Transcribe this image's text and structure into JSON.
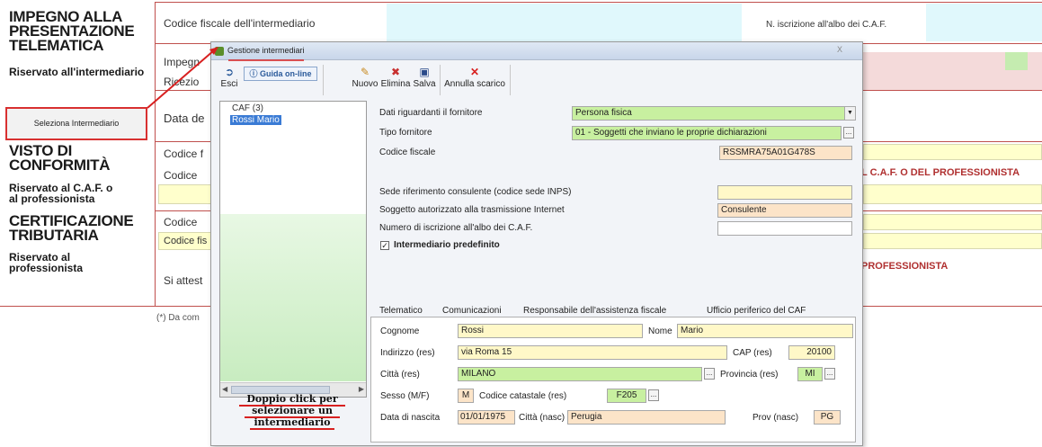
{
  "background_form": {
    "sections": [
      {
        "title": "IMPEGNO ALLA PRESENTAZIONE TELEMATICA",
        "subtitle": "Riservato all'intermediario"
      },
      {
        "title": "VISTO DI CONFORMITÀ",
        "subtitle": "Riservato al C.A.F. o al professionista"
      },
      {
        "title": "CERTIFICAZIONE TRIBUTARIA",
        "subtitle": "Riservato al professionista"
      }
    ],
    "row_labels": {
      "codice_fiscale_intermediario": "Codice fiscale dell'intermediario",
      "n_iscrizione": "N. iscrizione all'albo dei C.A.F.",
      "impegno": "Impegn",
      "ricezione": "Ricezio",
      "data": "Data de",
      "codice_1": "Codice f",
      "codice_2": "Codice",
      "codice_3": "Codice",
      "codice_4": "Codice fis",
      "si_attesta": "Si attest",
      "caf_professionista": "L C.A.F. O DEL PROFESSIONISTA",
      "professionista": "PROFESSIONISTA",
      "footnote": "(*) Da com"
    },
    "select_button": "Seleziona Intermediario"
  },
  "dialog": {
    "title": "Gestione intermediari",
    "close_label": "X",
    "toolbar": {
      "esci": "Esci",
      "guida": "Guida on-line",
      "nuovo": "Nuovo",
      "elimina": "Elimina",
      "salva": "Salva",
      "annulla_scarico": "Annulla scarico"
    },
    "tree": {
      "root": "CAF (3)",
      "selected": "Rossi  Mario"
    },
    "hint_lines": [
      "Doppio click per",
      "selezionare un",
      "intermediario"
    ],
    "form": {
      "dati_fornitore_label": "Dati riguardanti il fornitore",
      "dati_fornitore_value": "Persona fisica",
      "tipo_fornitore_label": "Tipo fornitore",
      "tipo_fornitore_value": "01 - Soggetti che inviano le proprie dichiarazioni",
      "codice_fiscale_label": "Codice fiscale",
      "codice_fiscale_value": "RSSMRA75A01G478S",
      "sede_label": "Sede riferimento consulente (codice sede INPS)",
      "sede_value": "",
      "soggetto_label": "Soggetto autorizzato alla trasmissione Internet",
      "soggetto_value": "Consulente",
      "numero_label": "Numero di iscrizione all'albo dei C.A.F.",
      "numero_value": "",
      "predefinito_label": "Intermediario predefinito",
      "predefinito_checked": true
    },
    "tabs": [
      "Telematico",
      "Comunicazioni",
      "Responsabile dell'assistenza fiscale",
      "Ufficio periferico del CAF"
    ],
    "telematico": {
      "cognome_label": "Cognome",
      "cognome_value": "Rossi",
      "nome_label": "Nome",
      "nome_value": "Mario",
      "indirizzo_label": "Indirizzo (res)",
      "indirizzo_value": "via Roma 15",
      "cap_label": "CAP (res)",
      "cap_value": "20100",
      "citta_label": "Città (res)",
      "citta_value": "MILANO",
      "provincia_label": "Provincia (res)",
      "provincia_value": "MI",
      "sesso_label": "Sesso (M/F)",
      "sesso_value": "M",
      "catastale_label": "Codice catastale (res)",
      "catastale_value": "F205",
      "nascita_label": "Data di nascita",
      "nascita_value": "01/01/1975",
      "citta_nasc_label": "Città (nasc)",
      "citta_nasc_value": "Perugia",
      "prov_nasc_label": "Prov (nasc)",
      "prov_nasc_value": "PG"
    }
  },
  "colors": {
    "form_line": "#c0504d",
    "highlight_red": "#d82020",
    "selection_blue": "#3a7bd5",
    "field_green": "#c8f0a0",
    "field_yellow": "#fff8c8",
    "field_peach": "#fce4c8"
  }
}
